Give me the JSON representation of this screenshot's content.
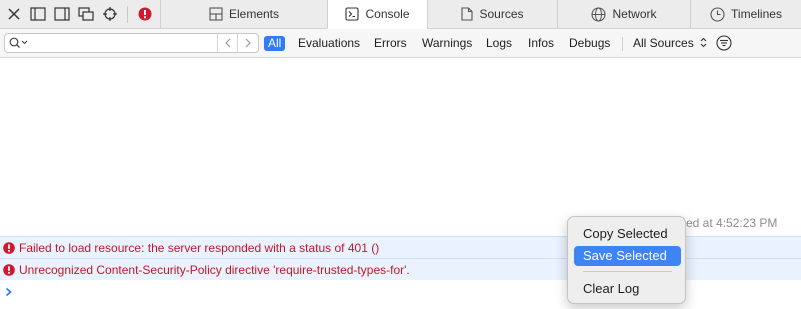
{
  "toolbar": {
    "icons": [
      "close-icon",
      "dock-left-icon",
      "dock-right-icon",
      "undock-icon",
      "element-picker-icon",
      "error-badge-icon"
    ],
    "tabs": [
      {
        "label": "Elements",
        "icon": "elements-icon",
        "active": false
      },
      {
        "label": "Console",
        "icon": "console-icon",
        "active": true
      },
      {
        "label": "Sources",
        "icon": "sources-icon",
        "active": false
      },
      {
        "label": "Network",
        "icon": "network-icon",
        "active": false
      },
      {
        "label": "Timelines",
        "icon": "timelines-icon",
        "active": false
      }
    ]
  },
  "filterbar": {
    "search": {
      "value": "",
      "placeholder": ""
    },
    "filters": [
      "All",
      "Evaluations",
      "Errors",
      "Warnings",
      "Logs",
      "Infos",
      "Debugs"
    ],
    "active_filter": "All",
    "sources": "All Sources"
  },
  "console": {
    "reloaded_text": "ed at 4:52:23 PM",
    "messages": [
      {
        "level": "error",
        "text": "Failed to load resource: the server responded with a status of 401 ()"
      },
      {
        "level": "error",
        "text": "Unrecognized Content-Security-Policy directive 'require-trusted-types-for'."
      }
    ]
  },
  "context_menu": {
    "items": [
      "Copy Selected",
      "Save Selected",
      "Clear Log"
    ],
    "highlighted": "Save Selected"
  },
  "colors": {
    "accent": "#2f7cf6",
    "error_text": "#c7152b",
    "error_icon": "#d0182f",
    "row_highlight": "#eaf2fd",
    "menu_highlight": "#3d85f4"
  }
}
